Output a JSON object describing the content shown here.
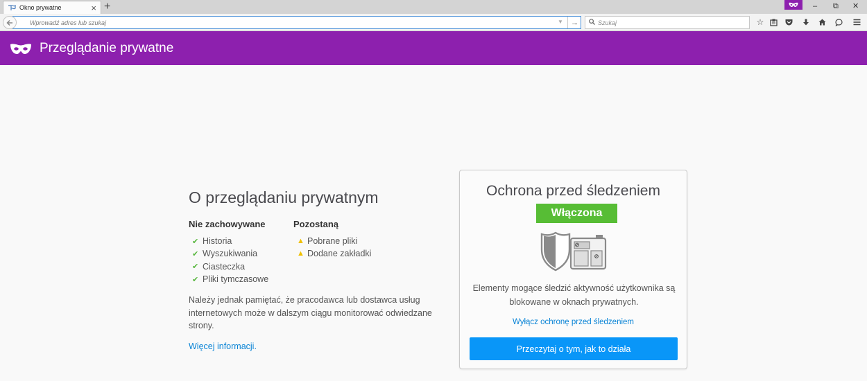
{
  "browser": {
    "tab": {
      "title": "Okno prywatne",
      "close": "×",
      "favicon": "private-window-icon"
    },
    "new_tab": "+",
    "window_controls": {
      "minimize": "–",
      "restore": "⧉",
      "close": "✕"
    },
    "urlbar": {
      "placeholder": "Wprowadź adres lub szukaj",
      "go": "→"
    },
    "searchbar": {
      "placeholder": "Szukaj"
    },
    "accent": "#8d20ae"
  },
  "header": {
    "title": "Przeglądanie prywatne"
  },
  "about": {
    "title": "O przeglądaniu prywatnym",
    "not_saved": {
      "heading": "Nie zachowywane",
      "items": [
        "Historia",
        "Wyszukiwania",
        "Ciasteczka",
        "Pliki tymczasowe"
      ]
    },
    "kept": {
      "heading": "Pozostaną",
      "items": [
        "Pobrane pliki",
        "Dodane zakładki"
      ]
    },
    "note": "Należy jednak pamiętać, że pracodawca lub dostawca usług internetowych może w dalszym ciągu monitorować odwiedzane strony.",
    "more_link": "Więcej informacji."
  },
  "tracking": {
    "title": "Ochrona przed śledzeniem",
    "status": "Włączona",
    "status_color": "#57bd35",
    "description": "Elementy mogące śledzić aktywność użytkownika są blokowane w oknach prywatnych.",
    "toggle_link": "Wyłącz ochronę przed śledzeniem",
    "learn_button": "Przeczytaj o tym, jak to działa"
  }
}
